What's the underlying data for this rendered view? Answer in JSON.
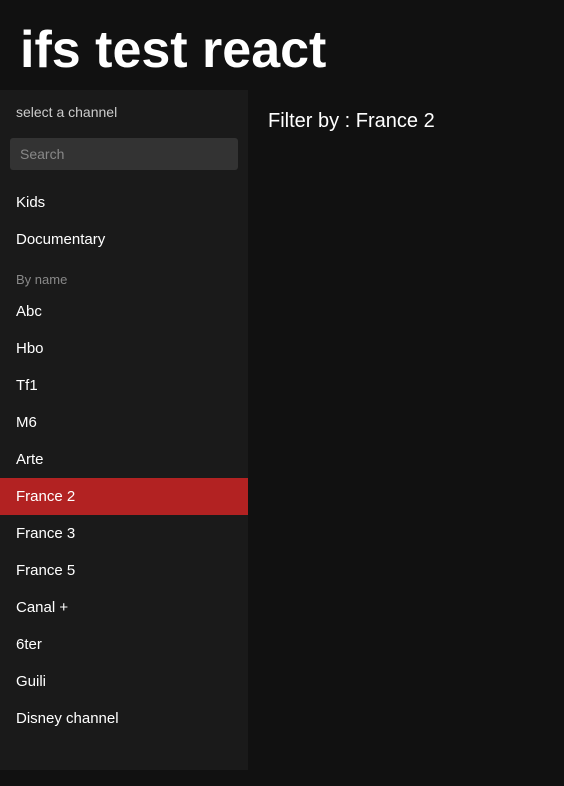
{
  "app": {
    "title": "ifs test react"
  },
  "sidebar": {
    "header": "select a channel",
    "search_placeholder": "Search",
    "categories": [
      {
        "label": "Kids"
      },
      {
        "label": "Documentary"
      }
    ],
    "section_label": "By name",
    "channels": [
      {
        "label": "Abc",
        "active": false
      },
      {
        "label": "Hbo",
        "active": false
      },
      {
        "label": "Tf1",
        "active": false
      },
      {
        "label": "M6",
        "active": false
      },
      {
        "label": "Arte",
        "active": false
      },
      {
        "label": "France 2",
        "active": true
      },
      {
        "label": "France 3",
        "active": false
      },
      {
        "label": "France 5",
        "active": false
      },
      {
        "label": "Canal +",
        "active": false
      },
      {
        "label": "6ter",
        "active": false
      },
      {
        "label": "Guili",
        "active": false
      },
      {
        "label": "Disney channel",
        "active": false
      }
    ]
  },
  "filter_display": {
    "label": "Filter by : France 2"
  }
}
